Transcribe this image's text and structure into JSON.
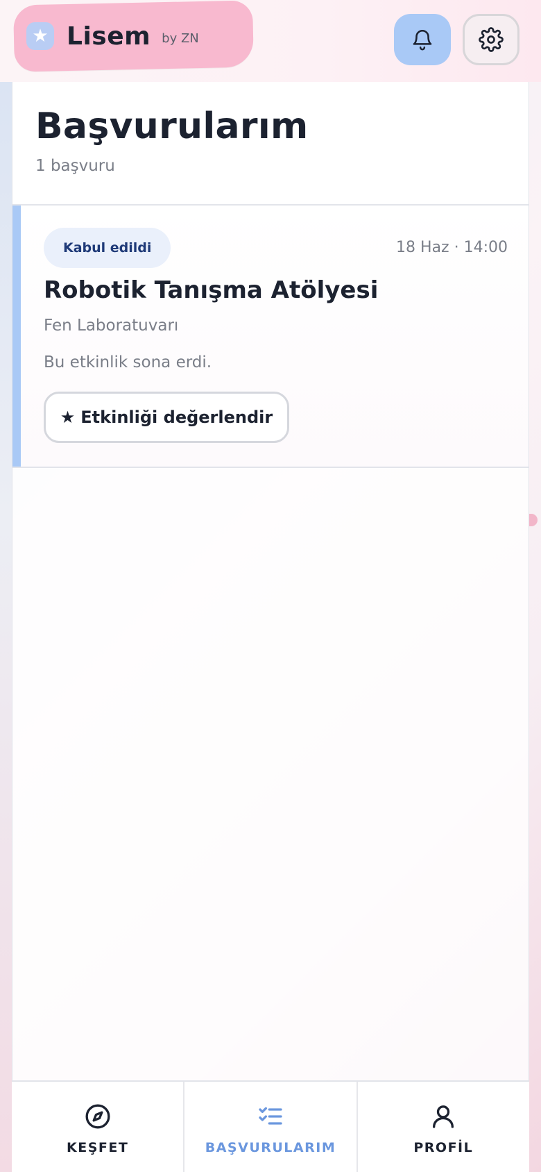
{
  "header": {
    "brand_name": "Lisem",
    "brand_by": "by ZN",
    "brand_logo_icon": "star-icon",
    "notifications_icon": "bell-icon",
    "settings_icon": "gear-icon"
  },
  "page": {
    "title": "Başvurularım",
    "count": "1 başvuru"
  },
  "applications": [
    {
      "status": "Kabul edildi",
      "date": "18 Haz · 14:00",
      "title": "Robotik Tanışma Atölyesi",
      "location": "Fen Laboratuvarı",
      "note": "Bu etkinlik sona erdi.",
      "action_icon": "★",
      "action_label": "Etkinliği değerlendir"
    }
  ],
  "nav": {
    "items": [
      {
        "label": "KEŞFET",
        "icon": "compass-icon",
        "active": false
      },
      {
        "label": "BAŞVURULARIM",
        "icon": "checklist-icon",
        "active": true
      },
      {
        "label": "PROFİL",
        "icon": "user-icon",
        "active": false
      }
    ]
  },
  "colors": {
    "brand_pink": "#f8b9cf",
    "accent_blue": "#a9c9f6",
    "active_nav": "#6b97de",
    "text_dark": "#1c2230",
    "text_muted": "#7a7e88"
  }
}
